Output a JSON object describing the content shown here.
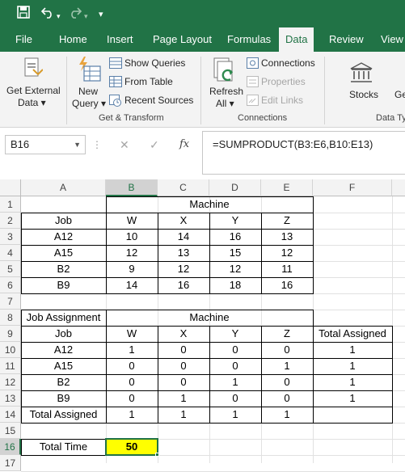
{
  "quick_access": {
    "save_icon": "save-icon",
    "undo_icon": "undo-icon",
    "redo_icon": "redo-icon",
    "customize_icon": "customize-qat-icon"
  },
  "tabs": [
    "File",
    "Home",
    "Insert",
    "Page Layout",
    "Formulas",
    "Data",
    "Review",
    "View"
  ],
  "active_tab": "Data",
  "ribbon": {
    "get_external_data": {
      "line1": "Get External",
      "line2": "Data ▾"
    },
    "new_query": {
      "line1": "New",
      "line2": "Query ▾"
    },
    "show_queries": "Show Queries",
    "from_table": "From Table",
    "recent_sources": "Recent Sources",
    "group_get_transform": "Get & Transform",
    "refresh_all": {
      "line1": "Refresh",
      "line2": "All ▾"
    },
    "connections": "Connections",
    "properties": "Properties",
    "edit_links": "Edit Links",
    "group_connections": "Connections",
    "stocks": "Stocks",
    "geo_partial": "Ge",
    "group_data_types_partial": "Data Ty"
  },
  "formula_bar": {
    "name_box": "B16",
    "cancel": "✕",
    "enter": "✓",
    "fx": "fx",
    "formula": "=SUMPRODUCT(B3:E6,B10:E13)"
  },
  "columns": [
    "A",
    "B",
    "C",
    "D",
    "E",
    "F"
  ],
  "selected_column": "B",
  "rows": [
    "1",
    "2",
    "3",
    "4",
    "5",
    "6",
    "7",
    "8",
    "9",
    "10",
    "11",
    "12",
    "13",
    "14",
    "15",
    "16",
    "17"
  ],
  "selected_row": "16",
  "sheet": {
    "times_title": "Machine",
    "job_label": "Job",
    "machines": [
      "W",
      "X",
      "Y",
      "Z"
    ],
    "times": [
      {
        "job": "A12",
        "vals": [
          "10",
          "14",
          "16",
          "13"
        ]
      },
      {
        "job": "A15",
        "vals": [
          "12",
          "13",
          "15",
          "12"
        ]
      },
      {
        "job": "B2",
        "vals": [
          "9",
          "12",
          "12",
          "11"
        ]
      },
      {
        "job": "B9",
        "vals": [
          "14",
          "16",
          "18",
          "16"
        ]
      }
    ],
    "assignment_label": "Job Assignment",
    "assignment_title": "Machine",
    "job_label2": "Job",
    "total_assigned_col": "Total Assigned",
    "assign": [
      {
        "job": "A12",
        "vals": [
          "1",
          "0",
          "0",
          "0"
        ],
        "total": "1"
      },
      {
        "job": "A15",
        "vals": [
          "0",
          "0",
          "0",
          "1"
        ],
        "total": "1"
      },
      {
        "job": "B2",
        "vals": [
          "0",
          "0",
          "1",
          "0"
        ],
        "total": "1"
      },
      {
        "job": "B9",
        "vals": [
          "0",
          "1",
          "0",
          "0"
        ],
        "total": "1"
      }
    ],
    "total_assigned_row_label": "Total Assigned",
    "total_assigned_row": [
      "1",
      "1",
      "1",
      "1"
    ],
    "total_time_label": "Total Time",
    "total_time_value": "50"
  },
  "colors": {
    "excel_green": "#217346",
    "highlight_yellow": "#ffff00"
  }
}
